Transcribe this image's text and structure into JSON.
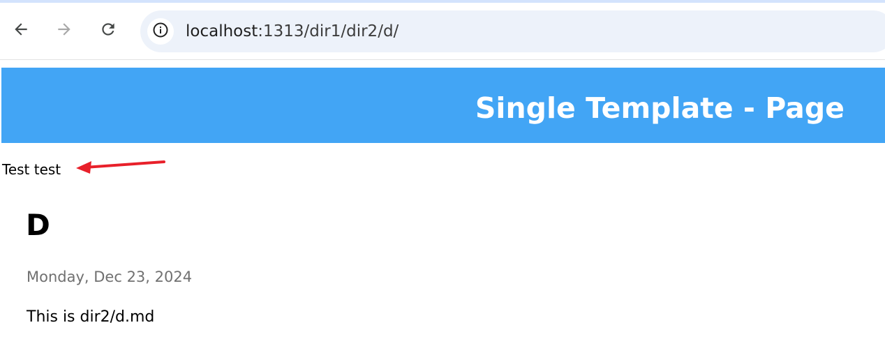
{
  "browser": {
    "back_icon": "arrow-left-icon",
    "forward_icon": "arrow-right-icon",
    "reload_icon": "reload-icon",
    "site_info_icon": "info-circle-icon",
    "url_host": "localhost",
    "url_path": ":1313/dir1/dir2/d/"
  },
  "header": {
    "title": "Single Template - Page",
    "background_color": "#42a5f5"
  },
  "annotation": {
    "text": "Test test",
    "arrow_color": "#e8202a"
  },
  "article": {
    "heading": "D",
    "date": "Monday, Dec 23, 2024",
    "body": "This is dir2/d.md"
  }
}
